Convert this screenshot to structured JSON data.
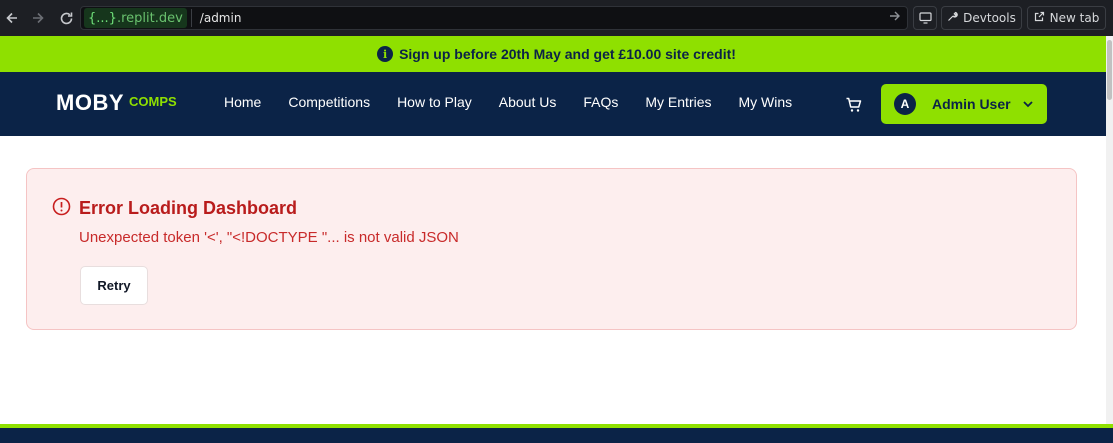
{
  "browser": {
    "url_host_braces": "{...}",
    "url_host_domain": ".replit.dev",
    "url_path": "/admin",
    "devtools_label": "Devtools",
    "newtab_label": "New tab",
    "icons": [
      "back-arrow-icon",
      "forward-arrow-icon",
      "reload-icon",
      "go-arrow-icon",
      "screen-icon",
      "wrench-icon",
      "external-link-icon"
    ]
  },
  "promo": {
    "text": "Sign up before 20th May and get £10.00 site credit!",
    "info_glyph": "i"
  },
  "header": {
    "logo_main": "MOBY",
    "logo_sub": "COMPS",
    "nav": [
      "Home",
      "Competitions",
      "How to Play",
      "About Us",
      "FAQs",
      "My Entries",
      "My Wins"
    ],
    "avatar_initial": "A",
    "user_name": "Admin User"
  },
  "error": {
    "title": "Error Loading Dashboard",
    "message": "Unexpected token '<', \"<!DOCTYPE \"... is not valid JSON",
    "retry_label": "Retry"
  },
  "colors": {
    "brand_navy": "#0b2347",
    "brand_green": "#8fe000",
    "error_red": "#b91c1c",
    "error_bg": "#fdeeee"
  }
}
